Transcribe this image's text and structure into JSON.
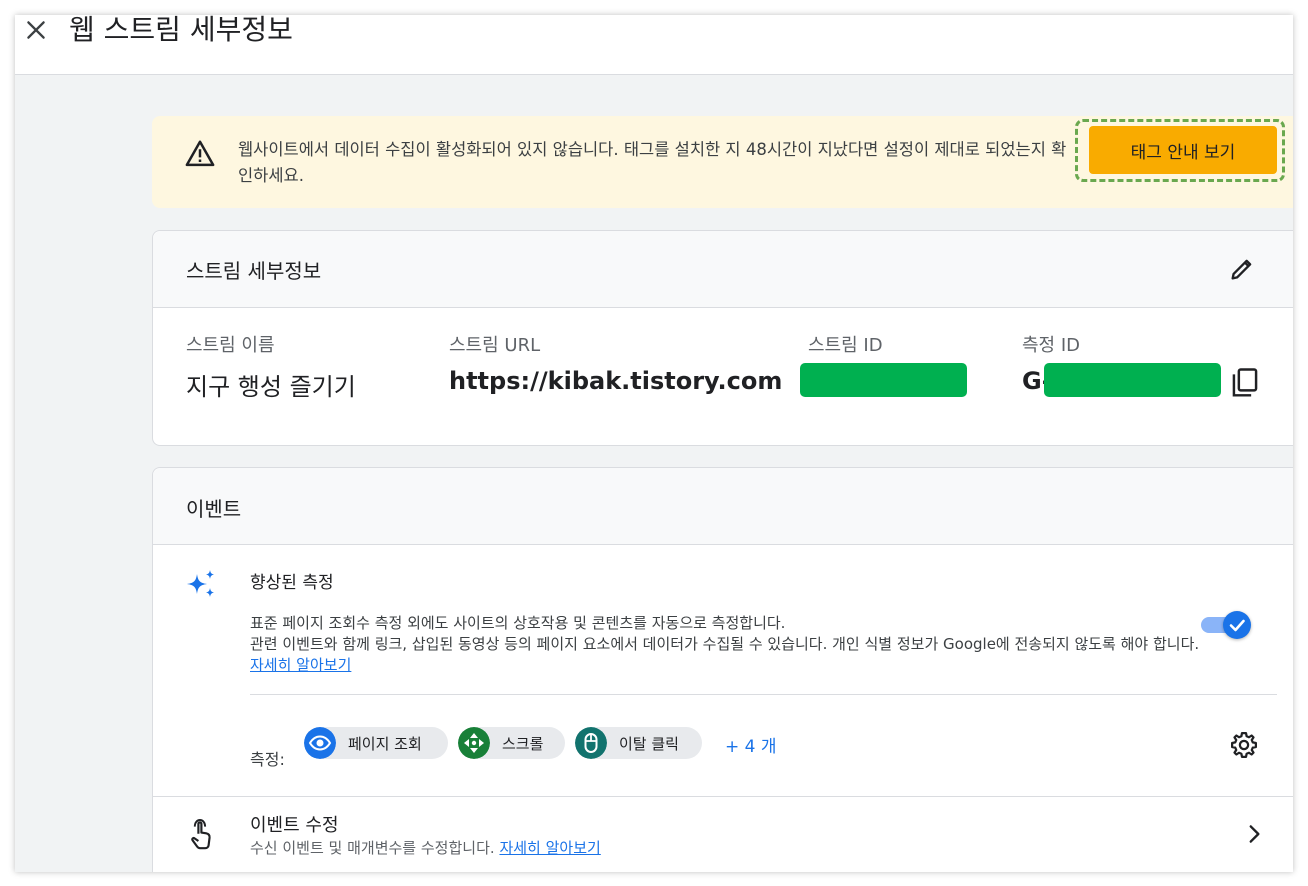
{
  "header": {
    "title": "웹 스트림 세부정보"
  },
  "banner": {
    "message": "웹사이트에서 데이터 수집이 활성화되어 있지 않습니다. 태그를 설치한 지 48시간이 지났다면 설정이 제대로 되었는지 확인하세요.",
    "button_label": "태그 안내 보기",
    "icon": "warning-icon"
  },
  "stream_details": {
    "title": "스트림 세부정보",
    "fields": [
      {
        "label": "스트림 이름",
        "value": "지구 행성 즐기기"
      },
      {
        "label": "스트림 URL",
        "value": "https://kibak.tistory.com"
      },
      {
        "label": "스트림 ID",
        "value": ""
      },
      {
        "label": "측정 ID",
        "value": "G-"
      }
    ]
  },
  "events": {
    "title": "이벤트",
    "enhanced": {
      "title": "향상된 측정",
      "desc_line1": "표준 페이지 조회수 측정 외에도 사이트의 상호작용 및 콘텐츠를 자동으로 측정합니다.",
      "desc_line2": "관련 이벤트와 함께 링크, 삽입된 동영상 등의 페이지 요소에서 데이터가 수집될 수 있습니다. 개인 식별 정보가 Google에 전송되지 않도록 해야 합니다.",
      "learn_more": "자세히 알아보기",
      "toggle_on": true
    },
    "measure_label": "측정:",
    "chips": [
      {
        "label": "페이지 조회",
        "icon": "eye-icon",
        "color": "#1a73e8"
      },
      {
        "label": "스크롤",
        "icon": "scroll-icon",
        "color": "#188038"
      },
      {
        "label": "이탈 클릭",
        "icon": "mouse-icon",
        "color": "#12736e"
      }
    ],
    "more_label": "+ 4 개",
    "modify": {
      "title": "이벤트 수정",
      "desc": "수신 이벤트 및 매개변수를 수정합니다.",
      "learn_more": "자세히 알아보기"
    }
  },
  "colors": {
    "accent": "#1a73e8",
    "cta": "#f9ab00",
    "banner_bg": "#fef7e0",
    "redaction": "#00b050"
  }
}
